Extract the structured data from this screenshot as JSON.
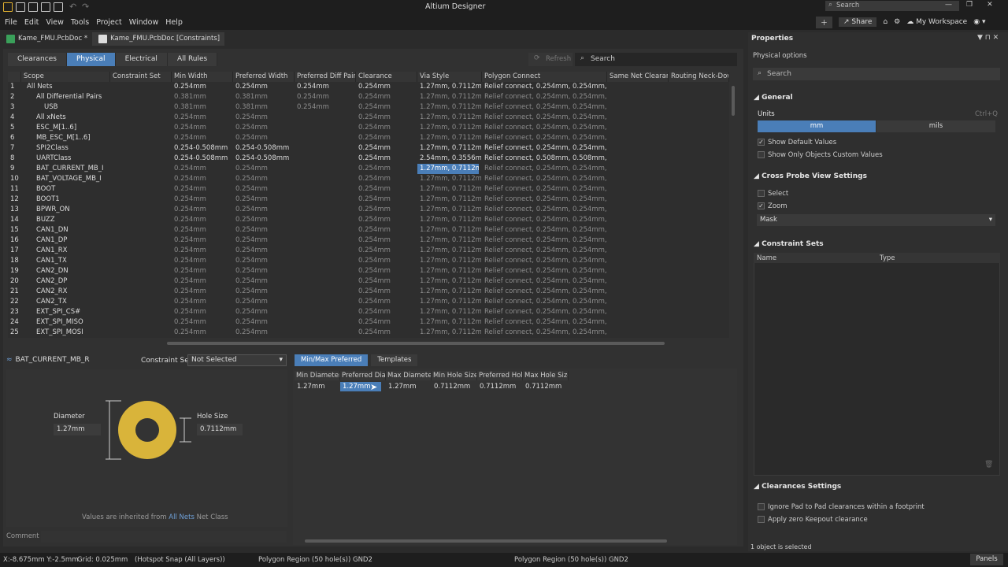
{
  "app": {
    "title": "Altium Designer",
    "search_placeholder": "Search"
  },
  "menu": [
    "File",
    "Edit",
    "View",
    "Tools",
    "Project",
    "Window",
    "Help"
  ],
  "toolbar": {
    "share": "Share",
    "workspace": "My Workspace"
  },
  "doc_tabs": [
    {
      "label": "Kame_FMU.PcbDoc *",
      "active": false
    },
    {
      "label": "Kame_FMU.PcbDoc [Constraints]",
      "active": true
    }
  ],
  "category_tabs": [
    "Clearances",
    "Physical",
    "Electrical",
    "All Rules"
  ],
  "active_category": "Physical",
  "refresh_label": "Refresh",
  "main_search_placeholder": "Search",
  "columns": [
    "Scope",
    "Constraint Set",
    "Min Width",
    "Preferred Width",
    "Preferred Diff Pair",
    "Clearance",
    "Via Style",
    "Polygon Connect",
    "Same Net Clearanc",
    "Routing Neck-Dow"
  ],
  "rows": [
    {
      "n": "1",
      "scope": "All Nets",
      "min": "0.254mm",
      "pref": "0.254mm",
      "diff": "0.254mm",
      "clr": "0.254mm",
      "via": "1.27mm, 0.7112mm",
      "poly": "Relief connect, 0.254mm, 0.254mm, 4, 90",
      "bright": true
    },
    {
      "n": "2",
      "scope": "All Differential Pairs",
      "min": "0.381mm",
      "pref": "0.381mm",
      "diff": "0.254mm",
      "clr": "0.254mm",
      "via": "1.27mm, 0.7112mm",
      "poly": "Relief connect, 0.254mm, 0.254mm, 4, 90",
      "bright": false
    },
    {
      "n": "3",
      "scope": "USB",
      "min": "0.381mm",
      "pref": "0.381mm",
      "diff": "0.254mm",
      "clr": "0.254mm",
      "via": "1.27mm, 0.7112mm",
      "poly": "Relief connect, 0.254mm, 0.254mm, 4, 90",
      "bright": false
    },
    {
      "n": "4",
      "scope": "All xNets",
      "min": "0.254mm",
      "pref": "0.254mm",
      "diff": "",
      "clr": "0.254mm",
      "via": "1.27mm, 0.7112mm",
      "poly": "Relief connect, 0.254mm, 0.254mm, 4, 90",
      "bright": false
    },
    {
      "n": "5",
      "scope": "ESC_M[1..6]",
      "min": "0.254mm",
      "pref": "0.254mm",
      "diff": "",
      "clr": "0.254mm",
      "via": "1.27mm, 0.7112mm",
      "poly": "Relief connect, 0.254mm, 0.254mm, 4, 90",
      "bright": false
    },
    {
      "n": "6",
      "scope": "MB_ESC_M[1..6]",
      "min": "0.254mm",
      "pref": "0.254mm",
      "diff": "",
      "clr": "0.254mm",
      "via": "1.27mm, 0.7112mm",
      "poly": "Relief connect, 0.254mm, 0.254mm, 4, 90",
      "bright": false
    },
    {
      "n": "7",
      "scope": "SPI2Class",
      "min": "0.254-0.508mm",
      "pref": "0.254-0.508mm",
      "diff": "",
      "clr": "0.254mm",
      "via": "1.27mm, 0.7112mm",
      "poly": "Relief connect, 0.254mm, 0.254mm, 4, 90",
      "bright": true
    },
    {
      "n": "8",
      "scope": "UARTClass",
      "min": "0.254-0.508mm",
      "pref": "0.254-0.508mm",
      "diff": "",
      "clr": "0.254mm",
      "via": "2.54mm, 0.3556mm",
      "poly": "Relief connect, 0.508mm, 0.508mm, 4, 90",
      "bright": true
    },
    {
      "n": "9",
      "scope": "BAT_CURRENT_MB_I",
      "min": "0.254mm",
      "pref": "0.254mm",
      "diff": "",
      "clr": "0.254mm",
      "via": "1.27mm, 0.7112mm",
      "poly": "Relief connect, 0.254mm, 0.254mm, 4, 90",
      "bright": false,
      "selvia": true
    },
    {
      "n": "10",
      "scope": "BAT_VOLTAGE_MB_I",
      "min": "0.254mm",
      "pref": "0.254mm",
      "diff": "",
      "clr": "0.254mm",
      "via": "1.27mm, 0.7112mm",
      "poly": "Relief connect, 0.254mm, 0.254mm, 4, 90",
      "bright": false
    },
    {
      "n": "11",
      "scope": "BOOT",
      "min": "0.254mm",
      "pref": "0.254mm",
      "diff": "",
      "clr": "0.254mm",
      "via": "1.27mm, 0.7112mm",
      "poly": "Relief connect, 0.254mm, 0.254mm, 4, 90",
      "bright": false
    },
    {
      "n": "12",
      "scope": "BOOT1",
      "min": "0.254mm",
      "pref": "0.254mm",
      "diff": "",
      "clr": "0.254mm",
      "via": "1.27mm, 0.7112mm",
      "poly": "Relief connect, 0.254mm, 0.254mm, 4, 90",
      "bright": false
    },
    {
      "n": "13",
      "scope": "BPWR_ON",
      "min": "0.254mm",
      "pref": "0.254mm",
      "diff": "",
      "clr": "0.254mm",
      "via": "1.27mm, 0.7112mm",
      "poly": "Relief connect, 0.254mm, 0.254mm, 4, 90",
      "bright": false
    },
    {
      "n": "14",
      "scope": "BUZZ",
      "min": "0.254mm",
      "pref": "0.254mm",
      "diff": "",
      "clr": "0.254mm",
      "via": "1.27mm, 0.7112mm",
      "poly": "Relief connect, 0.254mm, 0.254mm, 4, 90",
      "bright": false
    },
    {
      "n": "15",
      "scope": "CAN1_DN",
      "min": "0.254mm",
      "pref": "0.254mm",
      "diff": "",
      "clr": "0.254mm",
      "via": "1.27mm, 0.7112mm",
      "poly": "Relief connect, 0.254mm, 0.254mm, 4, 90",
      "bright": false
    },
    {
      "n": "16",
      "scope": "CAN1_DP",
      "min": "0.254mm",
      "pref": "0.254mm",
      "diff": "",
      "clr": "0.254mm",
      "via": "1.27mm, 0.7112mm",
      "poly": "Relief connect, 0.254mm, 0.254mm, 4, 90",
      "bright": false
    },
    {
      "n": "17",
      "scope": "CAN1_RX",
      "min": "0.254mm",
      "pref": "0.254mm",
      "diff": "",
      "clr": "0.254mm",
      "via": "1.27mm, 0.7112mm",
      "poly": "Relief connect, 0.254mm, 0.254mm, 4, 90",
      "bright": false
    },
    {
      "n": "18",
      "scope": "CAN1_TX",
      "min": "0.254mm",
      "pref": "0.254mm",
      "diff": "",
      "clr": "0.254mm",
      "via": "1.27mm, 0.7112mm",
      "poly": "Relief connect, 0.254mm, 0.254mm, 4, 90",
      "bright": false
    },
    {
      "n": "19",
      "scope": "CAN2_DN",
      "min": "0.254mm",
      "pref": "0.254mm",
      "diff": "",
      "clr": "0.254mm",
      "via": "1.27mm, 0.7112mm",
      "poly": "Relief connect, 0.254mm, 0.254mm, 4, 90",
      "bright": false
    },
    {
      "n": "20",
      "scope": "CAN2_DP",
      "min": "0.254mm",
      "pref": "0.254mm",
      "diff": "",
      "clr": "0.254mm",
      "via": "1.27mm, 0.7112mm",
      "poly": "Relief connect, 0.254mm, 0.254mm, 4, 90",
      "bright": false
    },
    {
      "n": "21",
      "scope": "CAN2_RX",
      "min": "0.254mm",
      "pref": "0.254mm",
      "diff": "",
      "clr": "0.254mm",
      "via": "1.27mm, 0.7112mm",
      "poly": "Relief connect, 0.254mm, 0.254mm, 4, 90",
      "bright": false
    },
    {
      "n": "22",
      "scope": "CAN2_TX",
      "min": "0.254mm",
      "pref": "0.254mm",
      "diff": "",
      "clr": "0.254mm",
      "via": "1.27mm, 0.7112mm",
      "poly": "Relief connect, 0.254mm, 0.254mm, 4, 90",
      "bright": false
    },
    {
      "n": "23",
      "scope": "EXT_SPI_CS#",
      "min": "0.254mm",
      "pref": "0.254mm",
      "diff": "",
      "clr": "0.254mm",
      "via": "1.27mm, 0.7112mm",
      "poly": "Relief connect, 0.254mm, 0.254mm, 4, 90",
      "bright": false
    },
    {
      "n": "24",
      "scope": "EXT_SPI_MISO",
      "min": "0.254mm",
      "pref": "0.254mm",
      "diff": "",
      "clr": "0.254mm",
      "via": "1.27mm, 0.7112mm",
      "poly": "Relief connect, 0.254mm, 0.254mm, 4, 90",
      "bright": false
    },
    {
      "n": "25",
      "scope": "EXT_SPI_MOSI",
      "min": "0.254mm",
      "pref": "0.254mm",
      "diff": "",
      "clr": "0.254mm",
      "via": "1.27mm, 0.7112mm",
      "poly": "Relief connect, 0.254mm, 0.254mm, 4, 90",
      "bright": false
    }
  ],
  "detail": {
    "net_name": "BAT_CURRENT_MB_R",
    "constraint_set_label": "Constraint Set",
    "constraint_set_value": "Not Selected",
    "diameter_label": "Diameter",
    "diameter_value": "1.27mm",
    "hole_label": "Hole Size",
    "hole_value": "0.7112mm",
    "inherit_prefix": "Values are inherited from",
    "inherit_link": "All Nets",
    "inherit_suffix": "Net Class",
    "comment_label": "Comment",
    "via_color": "#d9b43a"
  },
  "lower_tabs": [
    "Min/Max Preferred",
    "Templates"
  ],
  "via_columns": [
    "Min Diameter",
    "Preferred Dia",
    "Max Diamete",
    "Min Hole Size",
    "Preferred Hol",
    "Max Hole Size"
  ],
  "via_values": [
    "1.27mm",
    "1.27mm",
    "1.27mm",
    "0.7112mm",
    "0.7112mm",
    "0.7112mm"
  ],
  "properties": {
    "title": "Properties",
    "subtitle": "Physical options",
    "search_placeholder": "Search",
    "general": "General",
    "units_label": "Units",
    "units_shortcut": "Ctrl+Q",
    "unit_mm": "mm",
    "unit_mils": "mils",
    "show_default": "Show Default Values",
    "show_custom": "Show Only Objects Custom Values",
    "cross_probe": "Cross Probe View Settings",
    "select": "Select",
    "zoom": "Zoom",
    "mask": "Mask",
    "constraint_sets": "Constraint Sets",
    "cs_name": "Name",
    "cs_type": "Type",
    "clearances_settings": "Clearances Settings",
    "ignore_pad": "Ignore Pad to Pad clearances within a footprint",
    "apply_zero": "Apply zero Keepout clearance",
    "selected_count": "1 object is selected"
  },
  "status": {
    "coords": "X:-8.675mm Y:-2.5mm",
    "grid": "Grid: 0.025mm",
    "snap": "(Hotspot Snap (All Layers))",
    "left_msg": "Polygon Region (50 hole(s)) GND2",
    "mid_msg": "Polygon Region (50 hole(s)) GND2",
    "panels": "Panels"
  },
  "colors": {
    "accent": "#4a7eb8",
    "via": "#d9b43a"
  }
}
